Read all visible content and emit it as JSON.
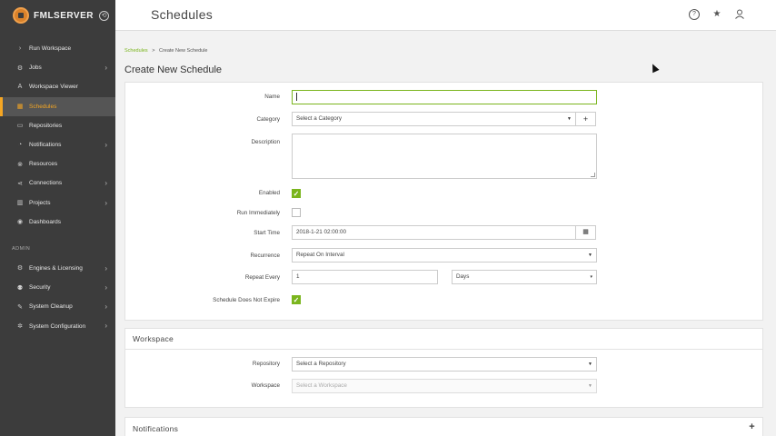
{
  "app": {
    "logo_text": "FMLSERVER",
    "back_glyph": "⟲"
  },
  "header": {
    "title": "Schedules",
    "icons": [
      "help-icon",
      "favorites-icon",
      "user-icon"
    ]
  },
  "sidebar": {
    "items": [
      {
        "label": "Run Workspace",
        "icon": "run-icon",
        "glyph": "›"
      },
      {
        "label": "Jobs",
        "icon": "jobs-icon",
        "glyph": "⚙",
        "has_children": true
      },
      {
        "label": "Workspace Viewer",
        "icon": "viewer-icon",
        "glyph": "A"
      },
      {
        "label": "Schedules",
        "icon": "calendar-icon",
        "glyph": "▦",
        "active": true
      },
      {
        "label": "Repositories",
        "icon": "folder-icon",
        "glyph": "▭"
      },
      {
        "label": "Notifications",
        "icon": "bell-icon",
        "glyph": "◔",
        "has_children": true
      },
      {
        "label": "Resources",
        "icon": "resources-icon",
        "glyph": "⊗"
      },
      {
        "label": "Connections",
        "icon": "connections-icon",
        "glyph": "⋖",
        "has_children": true
      },
      {
        "label": "Projects",
        "icon": "projects-icon",
        "glyph": "▥",
        "has_children": true
      },
      {
        "label": "Dashboards",
        "icon": "dashboard-icon",
        "glyph": "◉"
      }
    ],
    "admin_label": "ADMIN",
    "admin_items": [
      {
        "label": "Engines & Licensing",
        "icon": "engines-icon",
        "glyph": "⚙",
        "has_children": true
      },
      {
        "label": "Security",
        "icon": "security-icon",
        "glyph": "⚉",
        "has_children": true
      },
      {
        "label": "System Cleanup",
        "icon": "cleanup-icon",
        "glyph": "✎",
        "has_children": true
      },
      {
        "label": "System Configuration",
        "icon": "config-icon",
        "glyph": "✲",
        "has_children": true
      }
    ]
  },
  "breadcrumb": {
    "link": "Schedules",
    "separator": ">",
    "current": "Create New Schedule"
  },
  "page_title": "Create New Schedule",
  "form": {
    "name_label": "Name",
    "name_value": "",
    "category_label": "Category",
    "category_value": "Select a Category",
    "description_label": "Description",
    "enabled_label": "Enabled",
    "enabled": true,
    "run_immediately_label": "Run Immediately",
    "run_immediately": false,
    "start_time_label": "Start Time",
    "start_time_value": "2018-1-21 02:00:00",
    "recurrence_label": "Recurrence",
    "recurrence_value": "Repeat On Interval",
    "repeat_every_label": "Repeat Every",
    "repeat_every_value": "1",
    "repeat_unit_value": "Days",
    "no_expire_label": "Schedule Does Not Expire",
    "no_expire": true
  },
  "workspace_section": {
    "title": "Workspace",
    "repository_label": "Repository",
    "repository_value": "Select a Repository",
    "workspace_label": "Workspace",
    "workspace_value": "Select a Workspace"
  },
  "notifications_section": {
    "title": "Notifications"
  },
  "colors": {
    "accent": "#7ab51d",
    "sidebar": "#3c3c3c",
    "active": "#f5a623"
  }
}
